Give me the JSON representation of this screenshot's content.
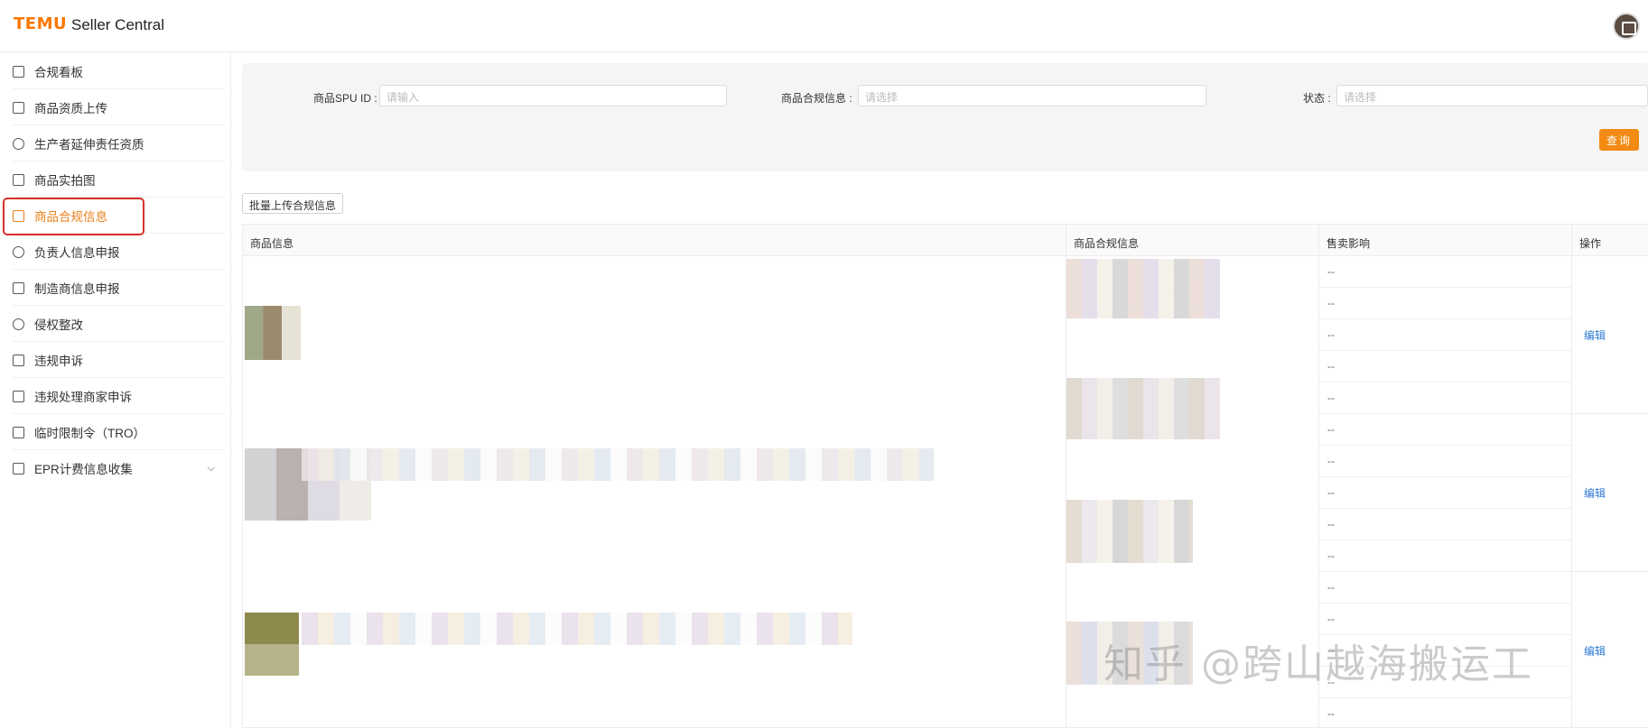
{
  "header": {
    "logo": "TEMU",
    "brand_sub": "Seller Central"
  },
  "sidebar": {
    "items": [
      {
        "label": "合规看板",
        "icon": "chart-icon"
      },
      {
        "label": "商品资质上传",
        "icon": "upload-icon"
      },
      {
        "label": "生产者延伸责任资质",
        "icon": "badge-icon"
      },
      {
        "label": "商品实拍图",
        "icon": "photo-icon"
      },
      {
        "label": "商品合规信息",
        "icon": "document-icon",
        "active": true
      },
      {
        "label": "负责人信息申报",
        "icon": "person-icon"
      },
      {
        "label": "制造商信息申报",
        "icon": "factory-icon"
      },
      {
        "label": "侵权整改",
        "icon": "shield-icon"
      },
      {
        "label": "违规申诉",
        "icon": "appeal-icon"
      },
      {
        "label": "违规处理商家申诉",
        "icon": "store-icon"
      },
      {
        "label": "临时限制令（TRO）",
        "icon": "calendar-icon"
      },
      {
        "label": "EPR计费信息收集",
        "icon": "form-icon"
      }
    ]
  },
  "filter": {
    "spu_label": "商品SPU ID :",
    "spu_placeholder": "请输入",
    "compliance_label": "商品合规信息 :",
    "compliance_placeholder": "请选择",
    "status_label": "状态 :",
    "status_placeholder": "请选择",
    "query_button": "查询"
  },
  "batch_button": "批量上传合规信息",
  "table": {
    "headers": [
      "商品信息",
      "商品合规信息",
      "售卖影响",
      "操作"
    ],
    "dash": "--",
    "edit_label": "编辑"
  },
  "watermark": "知乎 @跨山越海搬运工",
  "colors": {
    "accent": "#fb7701",
    "active_text": "#e8801b",
    "link": "#2f7ad4",
    "highlight_box": "#d9302a"
  }
}
